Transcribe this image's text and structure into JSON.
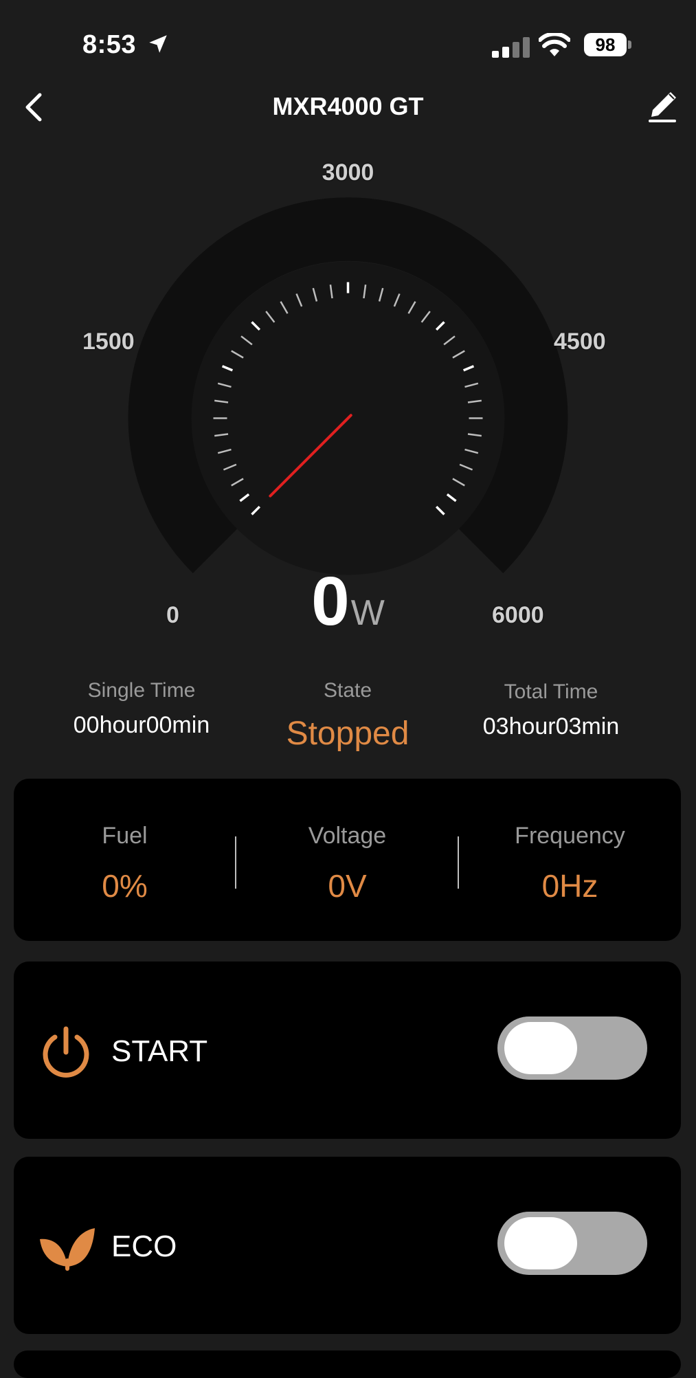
{
  "status_bar": {
    "time": "8:53",
    "battery": "98"
  },
  "nav": {
    "title": "MXR4000 GT"
  },
  "gauge": {
    "scale_labels": {
      "top": "3000",
      "left": "1500",
      "right": "4500",
      "min": "0",
      "max": "6000"
    },
    "min": 0,
    "max": 6000,
    "value": 0,
    "value_text": "0",
    "unit": "W"
  },
  "info": {
    "single_time_label": "Single Time",
    "single_time_value": "00hour00min",
    "state_label": "State",
    "state_value": "Stopped",
    "total_time_label": "Total Time",
    "total_time_value": "03hour03min"
  },
  "stats": [
    {
      "label": "Fuel",
      "value": "0%"
    },
    {
      "label": "Voltage",
      "value": "0V"
    },
    {
      "label": "Frequency",
      "value": "0Hz"
    }
  ],
  "controls": {
    "start": {
      "label": "START",
      "on": false
    },
    "eco": {
      "label": "ECO",
      "on": false
    }
  },
  "colors": {
    "accent": "#e08a45",
    "needle": "#e02020",
    "background": "#1c1c1c",
    "card": "#000000"
  }
}
